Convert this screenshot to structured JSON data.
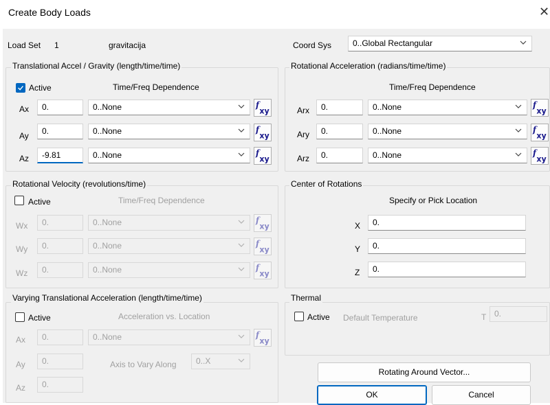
{
  "window": {
    "title": "Create Body Loads",
    "close_glyph": "✕"
  },
  "load_set": {
    "label": "Load Set",
    "number": "1",
    "name": "gravitacija"
  },
  "coord_sys": {
    "label": "Coord Sys",
    "value": "0..Global Rectangular"
  },
  "translational": {
    "title": "Translational Accel / Gravity  (length/time/time)",
    "active_label": "Active",
    "active_checked": true,
    "dependence_header": "Time/Freq Dependence",
    "rows": [
      {
        "label": "Ax",
        "value": "0.",
        "dependence": "0..None"
      },
      {
        "label": "Ay",
        "value": "0.",
        "dependence": "0..None"
      },
      {
        "label": "Az",
        "value": "-9.81",
        "dependence": "0..None"
      }
    ]
  },
  "rotational_accel": {
    "title": "Rotational Acceleration (radians/time/time)",
    "dependence_header": "Time/Freq Dependence",
    "rows": [
      {
        "label": "Arx",
        "value": "0.",
        "dependence": "0..None"
      },
      {
        "label": "Ary",
        "value": "0.",
        "dependence": "0..None"
      },
      {
        "label": "Arz",
        "value": "0.",
        "dependence": "0..None"
      }
    ]
  },
  "rotational_velocity": {
    "title": "Rotational Velocity (revolutions/time)",
    "active_label": "Active",
    "active_checked": false,
    "dependence_header": "Time/Freq Dependence",
    "rows": [
      {
        "label": "Wx",
        "value": "0.",
        "dependence": "0..None"
      },
      {
        "label": "Wy",
        "value": "0.",
        "dependence": "0..None"
      },
      {
        "label": "Wz",
        "value": "0.",
        "dependence": "0..None"
      }
    ]
  },
  "center_of_rotations": {
    "title": "Center of Rotations",
    "header": "Specify or Pick Location",
    "rows": [
      {
        "label": "X",
        "value": "0."
      },
      {
        "label": "Y",
        "value": "0."
      },
      {
        "label": "Z",
        "value": "0."
      }
    ]
  },
  "varying": {
    "title": "Varying Translational Acceleration   (length/time/time)",
    "active_label": "Active",
    "active_checked": false,
    "header": "Acceleration vs. Location",
    "ax": {
      "label": "Ax",
      "value": "0.",
      "dependence": "0..None"
    },
    "ay": {
      "label": "Ay",
      "value": "0."
    },
    "az": {
      "label": "Az",
      "value": "0."
    },
    "axis_label": "Axis to Vary Along",
    "axis_value": "0..X"
  },
  "thermal": {
    "title": "Thermal",
    "active_label": "Active",
    "active_checked": false,
    "default_temp_label": "Default Temperature",
    "t_label": "T",
    "t_value": "0."
  },
  "buttons": {
    "rotating": "Rotating Around Vector...",
    "ok": "OK",
    "cancel": "Cancel"
  },
  "colors": {
    "accent": "#0067c0",
    "fx_icon": "#1a1a8c",
    "dialog_bg": "#f0f0f0"
  }
}
